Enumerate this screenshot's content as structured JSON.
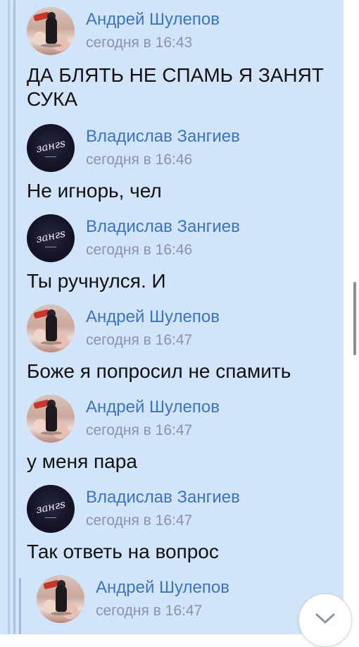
{
  "messages": [
    {
      "author": "Андрей Шулепов",
      "time": "сегодня в 16:43",
      "text": "ДА БЛЯТЬ НЕ СПАМЬ Я ЗАНЯТ СУКА",
      "avatar": "photo-avatar"
    },
    {
      "author": "Владислав Зангиев",
      "time": "сегодня в 16:46",
      "text": "Не игнорь, чел",
      "avatar": "logo-avatar"
    },
    {
      "author": "Владислав Зангиев",
      "time": "сегодня в 16:46",
      "text": "Ты ручнулся. И",
      "avatar": "logo-avatar"
    },
    {
      "author": "Андрей Шулепов",
      "time": "сегодня в 16:47",
      "text": "Боже я попросил не спамить",
      "avatar": "photo-avatar"
    },
    {
      "author": "Андрей Шулепов",
      "time": "сегодня в 16:47",
      "text": "у меня пара",
      "avatar": "photo-avatar"
    },
    {
      "author": "Владислав Зангиев",
      "time": "сегодня в 16:47",
      "text": "Так ответь на вопрос",
      "avatar": "logo-avatar"
    },
    {
      "author": "Андрей Шулепов",
      "time": "сегодня в 16:47",
      "text": "",
      "avatar": "photo-avatar"
    }
  ],
  "logo_avatar_text": "зангs",
  "scroll_down_icon": "chevron-down-icon",
  "colors": {
    "panel": "#d2e4fa",
    "author": "#3a74c2",
    "time": "#8595aa",
    "text": "#111111"
  }
}
